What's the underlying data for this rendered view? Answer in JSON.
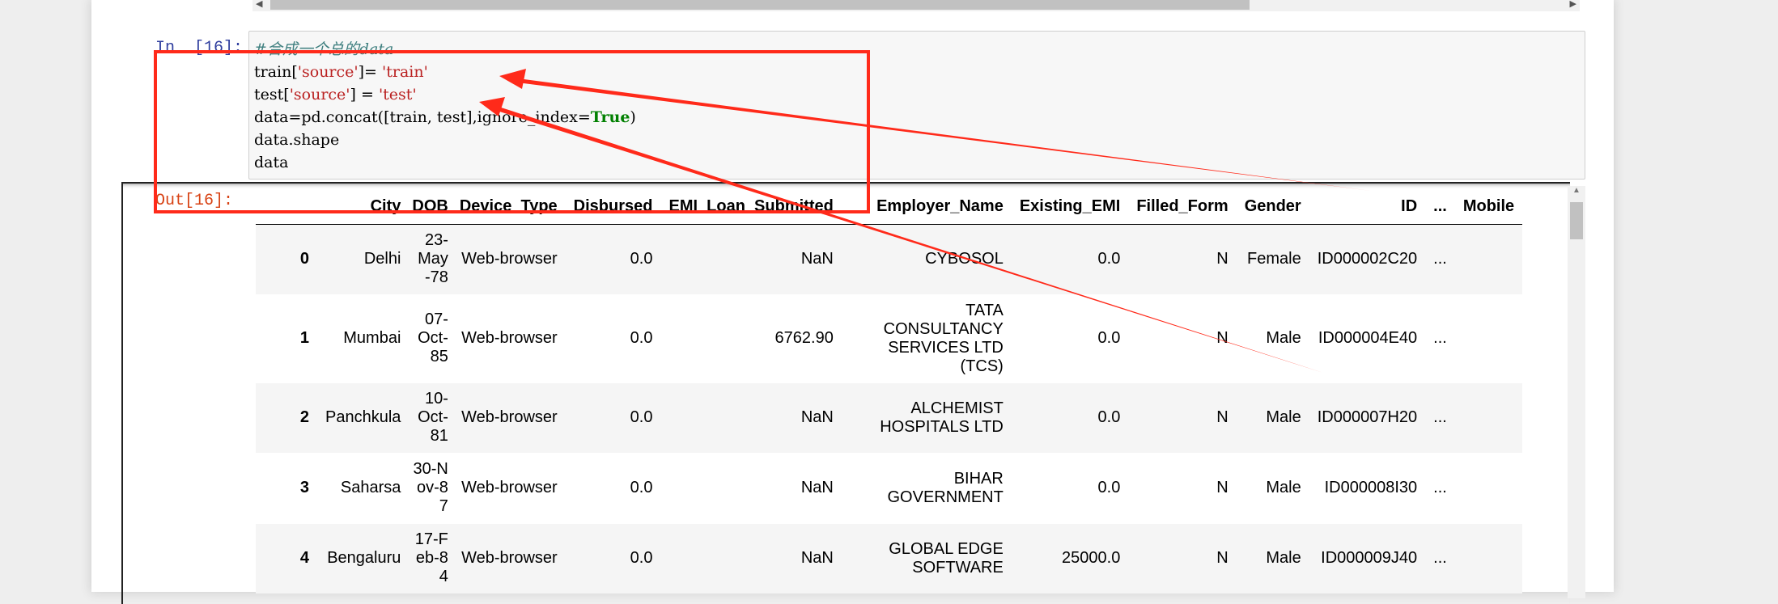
{
  "cell": {
    "in_prompt": "In  [16]:",
    "out_prompt": "Out[16]:",
    "code": {
      "comment": "#合成一个总的data",
      "l2_a": "train[",
      "l2_b": "'source'",
      "l2_c": "]= ",
      "l2_d": "'train'",
      "l3_a": "test[",
      "l3_b": "'source'",
      "l3_c": "] = ",
      "l3_d": "'test'",
      "l4_a": "data=pd.concat([train, test],ignore_index=",
      "l4_b": "True",
      "l4_c": ")",
      "l5": "data.shape",
      "l6": "data"
    }
  },
  "table": {
    "columns": [
      "",
      "City",
      "DOB",
      "Device_Type",
      "Disbursed",
      "EMI_Loan_Submitted",
      "Employer_Name",
      "Existing_EMI",
      "Filled_Form",
      "Gender",
      "ID",
      "...",
      "Mobile"
    ],
    "rows": [
      {
        "idx": "0",
        "city": "Delhi",
        "dob": "23-May-78",
        "device": "Web-browser",
        "disbursed": "0.0",
        "emi_loan": "NaN",
        "employer": "CYBOSOL",
        "existing_emi": "0.0",
        "filled": "N",
        "gender": "Female",
        "id": "ID000002C20",
        "ellipsis": "..."
      },
      {
        "idx": "1",
        "city": "Mumbai",
        "dob": "07-Oct-85",
        "device": "Web-browser",
        "disbursed": "0.0",
        "emi_loan": "6762.90",
        "employer": "TATA CONSULTANCY SERVICES LTD (TCS)",
        "existing_emi": "0.0",
        "filled": "N",
        "gender": "Male",
        "id": "ID000004E40",
        "ellipsis": "..."
      },
      {
        "idx": "2",
        "city": "Panchkula",
        "dob": "10-Oct-81",
        "device": "Web-browser",
        "disbursed": "0.0",
        "emi_loan": "NaN",
        "employer": "ALCHEMIST HOSPITALS LTD",
        "existing_emi": "0.0",
        "filled": "N",
        "gender": "Male",
        "id": "ID000007H20",
        "ellipsis": "..."
      },
      {
        "idx": "3",
        "city": "Saharsa",
        "dob": "30-Nov-87",
        "device": "Web-browser",
        "disbursed": "0.0",
        "emi_loan": "NaN",
        "employer": "BIHAR GOVERNMENT",
        "existing_emi": "0.0",
        "filled": "N",
        "gender": "Male",
        "id": "ID000008I30",
        "ellipsis": "..."
      },
      {
        "idx": "4",
        "city": "Bengaluru",
        "dob": "17-Feb-84",
        "device": "Web-browser",
        "disbursed": "0.0",
        "emi_loan": "NaN",
        "employer": "GLOBAL EDGE SOFTWARE",
        "existing_emi": "25000.0",
        "filled": "N",
        "gender": "Male",
        "id": "ID000009J40",
        "ellipsis": "..."
      }
    ]
  },
  "colors": {
    "annotation": "#ff2a1a",
    "in_prompt": "#303f9f",
    "out_prompt": "#d84315"
  }
}
